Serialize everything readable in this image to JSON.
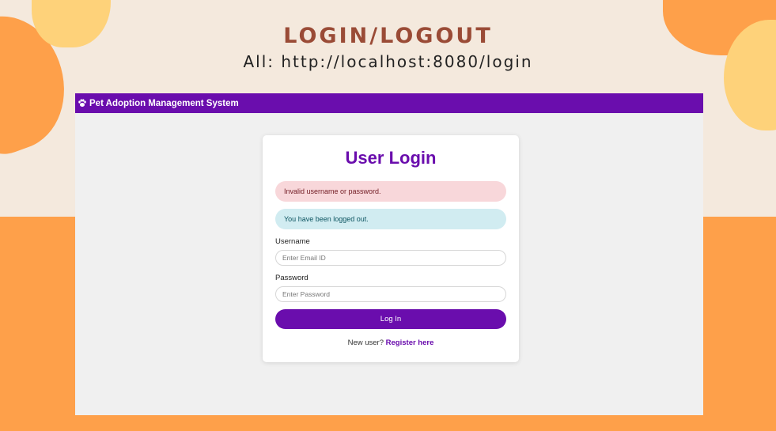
{
  "slide": {
    "title": "LOGIN/LOGOUT",
    "url_line": "All: http://localhost:8080/login"
  },
  "navbar": {
    "brand": "Pet Adoption Management System",
    "icon": "paw-icon"
  },
  "login_card": {
    "title": "User Login",
    "error_alert": "Invalid username or password.",
    "info_alert": "You have been logged out.",
    "username_label": "Username",
    "username_placeholder": "Enter Email ID",
    "password_label": "Password",
    "password_placeholder": "Enter Password",
    "login_button": "Log In",
    "register_prompt": "New user?",
    "register_link": "Register here"
  },
  "colors": {
    "accent": "#6a0dad",
    "background_orange": "#fea04a",
    "background_cream": "#f4e9dd",
    "title_brown": "#9a4b36"
  }
}
